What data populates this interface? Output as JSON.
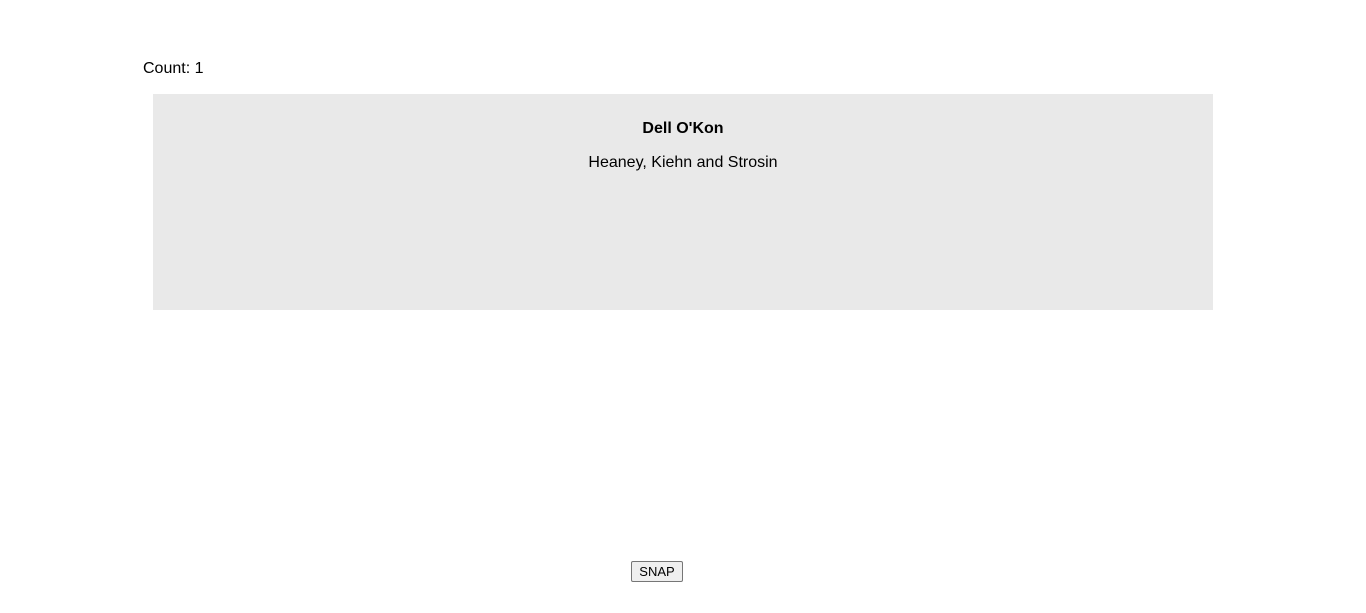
{
  "counter": {
    "label": "Count:",
    "value": "1"
  },
  "card": {
    "name": "Dell O'Kon",
    "company": "Heaney, Kiehn and Strosin"
  },
  "actions": {
    "snap_label": "SNAP"
  }
}
